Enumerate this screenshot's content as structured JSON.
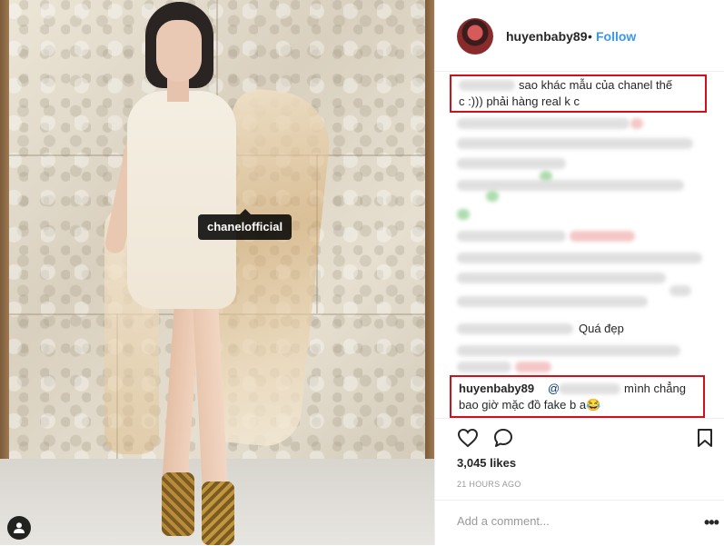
{
  "photo": {
    "tag_label": "chanelofficial",
    "user_tag_icon": "person-icon"
  },
  "header": {
    "username": "huyenbaby89",
    "separator": "•",
    "follow_label": "Follow"
  },
  "comments": {
    "first": {
      "line1": "sao khác mẫu của chanel thế",
      "line2": "c :))) phải hàng real k c"
    },
    "quote_reply": "Quá đẹp",
    "reply": {
      "username": "huyenbaby89",
      "mention": "@",
      "line1": "mình chẳng",
      "line2": "bao giờ mặc đồ fake b a😂"
    }
  },
  "actions": {
    "like_icon": "heart-icon",
    "comment_icon": "comment-icon",
    "save_icon": "bookmark-icon"
  },
  "likes_text": "3,045 likes",
  "timestamp": "21 HOURS AGO",
  "add_comment": {
    "placeholder": "Add a comment...",
    "more_label": "•••"
  },
  "colors": {
    "accent_blue": "#3897f0",
    "highlight_red": "#d0101a"
  }
}
